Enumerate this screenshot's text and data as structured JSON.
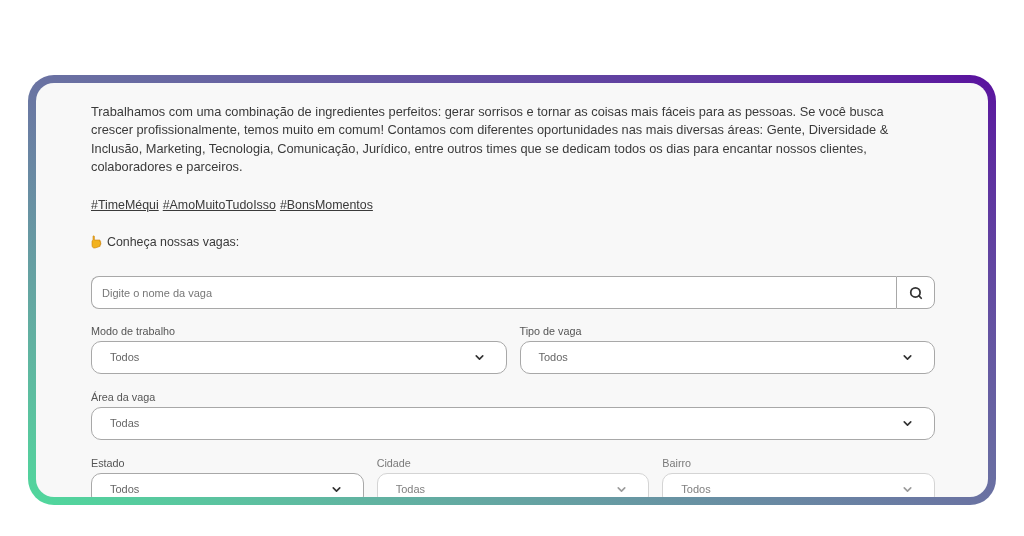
{
  "intro": {
    "paragraph": "Trabalhamos com uma combinação de ingredientes perfeitos: gerar sorrisos e tornar as coisas mais fáceis para as pessoas. Se você busca crescer profissionalmente, temos muito em comum! Contamos com diferentes oportunidades nas mais diversas áreas: Gente, Diversidade & Inclusão, Marketing, Tecnologia, Comunicação, Jurídico, entre outros times que se dedicam todos os dias para encantar nossos clientes, colaboradores e parceiros.",
    "hashtags": [
      "#TimeMéqui",
      "#AmoMuitoTudoIsso",
      "#BonsMomentos"
    ],
    "vacancies_heading": "Conheça nossas vagas:"
  },
  "search": {
    "placeholder": "Digite o nome da vaga"
  },
  "filter_rows": [
    {
      "fields": [
        {
          "label": "Modo de trabalho",
          "value": "Todos",
          "disabled": false
        },
        {
          "label": "Tipo de vaga",
          "value": "Todos",
          "disabled": false
        }
      ]
    },
    {
      "fields": [
        {
          "label": "Área da vaga",
          "value": "Todas",
          "disabled": false
        }
      ]
    },
    {
      "fields": [
        {
          "label": "Estado",
          "value": "Todos",
          "disabled": false
        },
        {
          "label": "Cidade",
          "value": "Todas",
          "disabled": true
        },
        {
          "label": "Bairro",
          "value": "Todos",
          "disabled": true
        }
      ]
    }
  ]
}
